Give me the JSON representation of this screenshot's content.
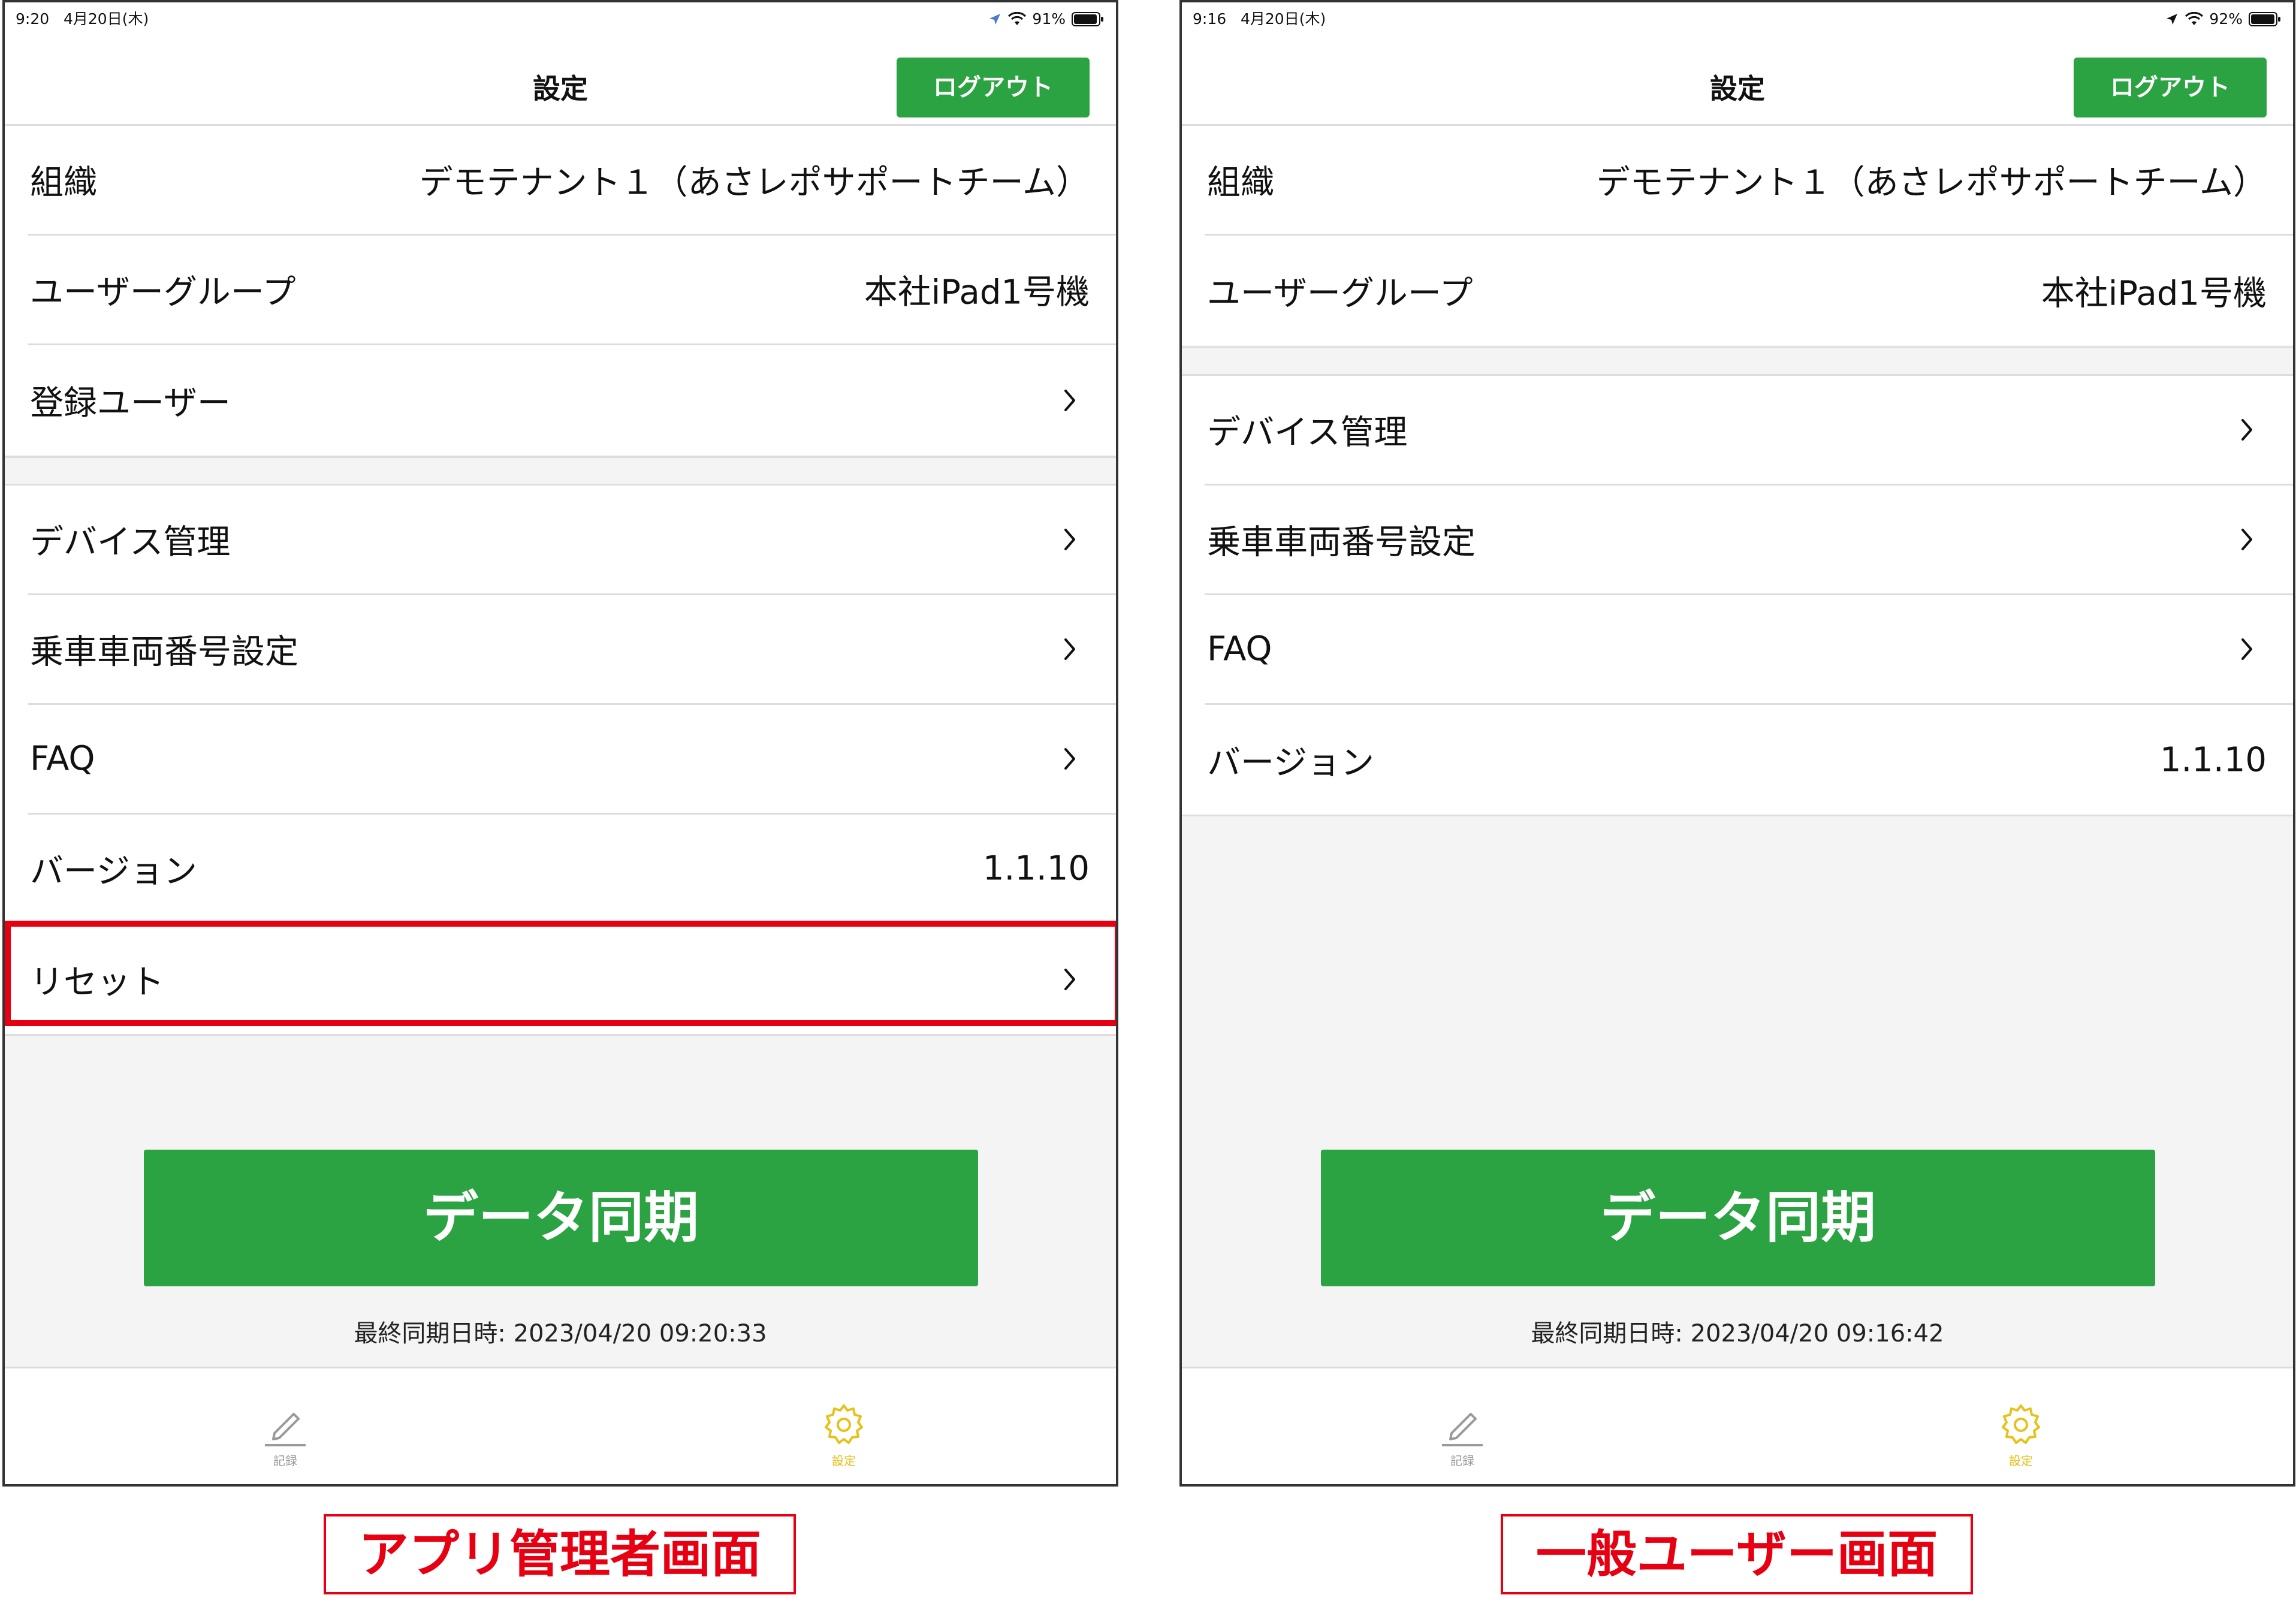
{
  "colors": {
    "accent_green": "#2ca342",
    "highlight_red": "#e60012",
    "tab_active": "#e6c21c",
    "tab_inactive": "#9a9a9a"
  },
  "admin": {
    "status": {
      "time": "9:20",
      "date": "4月20日(木)",
      "battery": "91%"
    },
    "nav": {
      "title": "設定",
      "logout": "ログアウト"
    },
    "rows": [
      {
        "label": "組織",
        "value": "デモテナント１（あさレポサポートチーム）"
      },
      {
        "label": "ユーザーグループ",
        "value": "本社iPad1号機"
      },
      {
        "label": "登録ユーザー"
      },
      {
        "label": "デバイス管理"
      },
      {
        "label": "乗車車両番号設定"
      },
      {
        "label": "FAQ"
      },
      {
        "label": "バージョン",
        "value": "1.1.10"
      },
      {
        "label": "リセット"
      }
    ],
    "sync": {
      "label": "データ同期",
      "last": "最終同期日時: 2023/04/20 09:20:33"
    },
    "tabs": {
      "record": "記録",
      "settings": "設定"
    },
    "caption": "アプリ管理者画面"
  },
  "user": {
    "status": {
      "time": "9:16",
      "date": "4月20日(木)",
      "battery": "92%"
    },
    "nav": {
      "title": "設定",
      "logout": "ログアウト"
    },
    "rows": [
      {
        "label": "組織",
        "value": "デモテナント１（あさレポサポートチーム）"
      },
      {
        "label": "ユーザーグループ",
        "value": "本社iPad1号機"
      },
      {
        "label": "デバイス管理"
      },
      {
        "label": "乗車車両番号設定"
      },
      {
        "label": "FAQ"
      },
      {
        "label": "バージョン",
        "value": "1.1.10"
      }
    ],
    "sync": {
      "label": "データ同期",
      "last": "最終同期日時: 2023/04/20 09:16:42"
    },
    "tabs": {
      "record": "記録",
      "settings": "設定"
    },
    "caption": "一般ユーザー画面"
  }
}
